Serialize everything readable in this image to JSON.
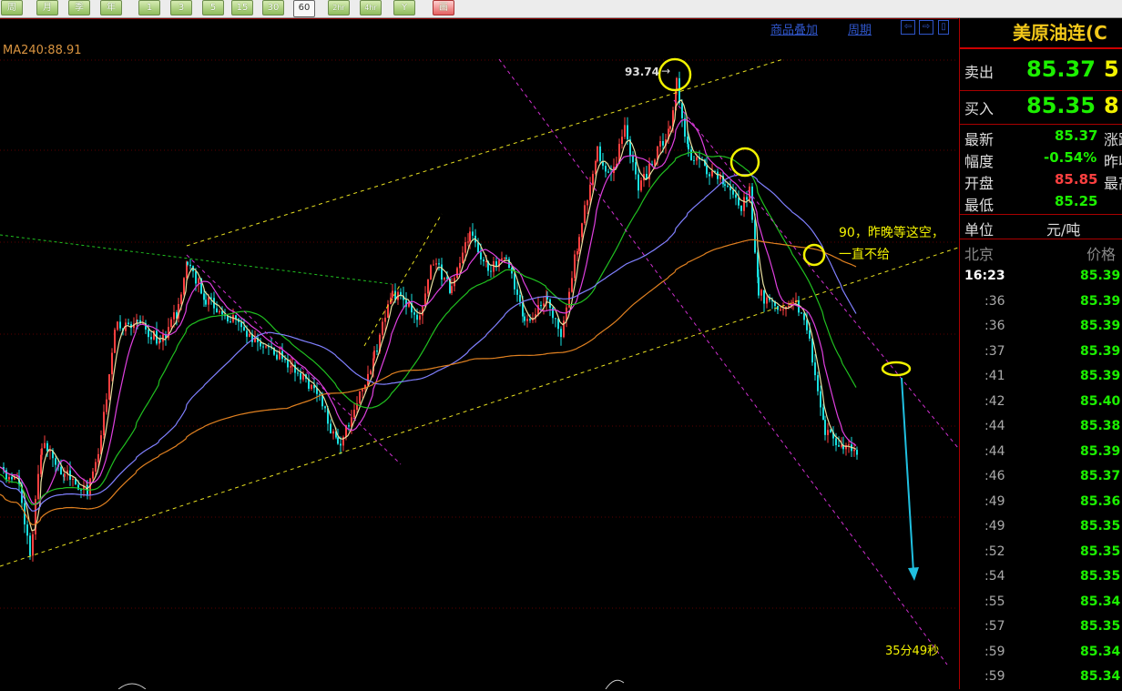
{
  "toolbar": {
    "buttons": [
      "周",
      "月",
      "季",
      "年",
      "1",
      "3",
      "5",
      "15",
      "30",
      "60",
      "2hr",
      "4hr",
      "Y",
      "画"
    ],
    "active": "60"
  },
  "chart": {
    "ma_label": "MA240:88.91",
    "link_overlay": "商品叠加",
    "link_period": "周期",
    "peak_label": "93.74",
    "annotation_line1": "90，昨晚等这空，",
    "annotation_line2": "一直不给",
    "timer": "35分49秒",
    "nav_icons": [
      "⇦",
      "⇨",
      "▯"
    ],
    "colors": {
      "up": "#ff4040",
      "down": "#18e0e0",
      "ma1": "#e8e0a0",
      "ma2": "#e040e0",
      "ma3": "#20c020",
      "ma4": "#8080ff",
      "ma5": "#e08020",
      "annotation": "#f2f200"
    }
  },
  "panel": {
    "title": "美原油连(C",
    "sell_label": "卖出",
    "sell_price": "85.37",
    "sell_qty": "5",
    "buy_label": "买入",
    "buy_price": "85.35",
    "buy_qty": "8",
    "stats": [
      {
        "label": "最新",
        "value": "85.37",
        "extra": "涨跌"
      },
      {
        "label": "幅度",
        "value": "-0.54%",
        "extra": "昨收"
      },
      {
        "label": "开盘",
        "value": "85.85",
        "extra": "最高"
      },
      {
        "label": "最低",
        "value": "85.25",
        "extra": ""
      }
    ],
    "unit_label": "单位",
    "unit_value": "元/吨",
    "ticks_header_left": "北京",
    "ticks_header_right": "价格",
    "ticks": [
      {
        "time": "16:23",
        "price": "85.39"
      },
      {
        "time": ":36",
        "price": "85.39"
      },
      {
        "time": ":36",
        "price": "85.39"
      },
      {
        "time": ":37",
        "price": "85.39"
      },
      {
        "time": ":41",
        "price": "85.39"
      },
      {
        "time": ":42",
        "price": "85.40"
      },
      {
        "time": ":44",
        "price": "85.38"
      },
      {
        "time": ":44",
        "price": "85.39"
      },
      {
        "time": ":46",
        "price": "85.37"
      },
      {
        "time": ":49",
        "price": "85.36"
      },
      {
        "time": ":49",
        "price": "85.35"
      },
      {
        "time": ":52",
        "price": "85.35"
      },
      {
        "time": ":54",
        "price": "85.35"
      },
      {
        "time": ":55",
        "price": "85.34"
      },
      {
        "time": ":57",
        "price": "85.35"
      },
      {
        "time": ":59",
        "price": "85.34"
      },
      {
        "time": ":59",
        "price": "85.34"
      }
    ]
  }
}
